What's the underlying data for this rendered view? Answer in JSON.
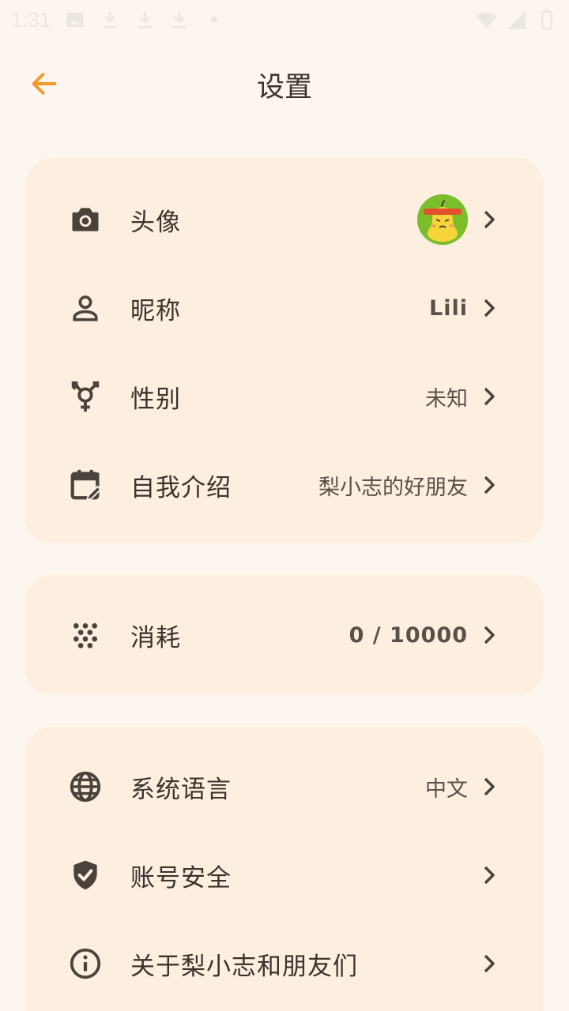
{
  "status_bar": {
    "time": "1:31"
  },
  "header": {
    "title": "设置",
    "back_icon": "arrow-left-icon"
  },
  "colors": {
    "background": "#FDF6EF",
    "card": "#FCEFE0",
    "accent": "#F39A2E",
    "text": "#3B332C"
  },
  "profile_card": {
    "items": [
      {
        "label": "头像",
        "icon": "camera-icon",
        "value": ""
      },
      {
        "label": "昵称",
        "icon": "person-icon",
        "value": "Lili"
      },
      {
        "label": "性别",
        "icon": "gender-icon",
        "value": "未知"
      },
      {
        "label": "自我介绍",
        "icon": "calendar-edit-icon",
        "value": "梨小志的好朋友"
      }
    ]
  },
  "usage_card": {
    "items": [
      {
        "label": "消耗",
        "icon": "dots-icon",
        "value": "0 / 10000"
      }
    ]
  },
  "system_card": {
    "items": [
      {
        "label": "系统语言",
        "icon": "globe-icon",
        "value": "中文"
      },
      {
        "label": "账号安全",
        "icon": "shield-check-icon",
        "value": ""
      },
      {
        "label": "关于梨小志和朋友们",
        "icon": "info-icon",
        "value": ""
      }
    ]
  }
}
